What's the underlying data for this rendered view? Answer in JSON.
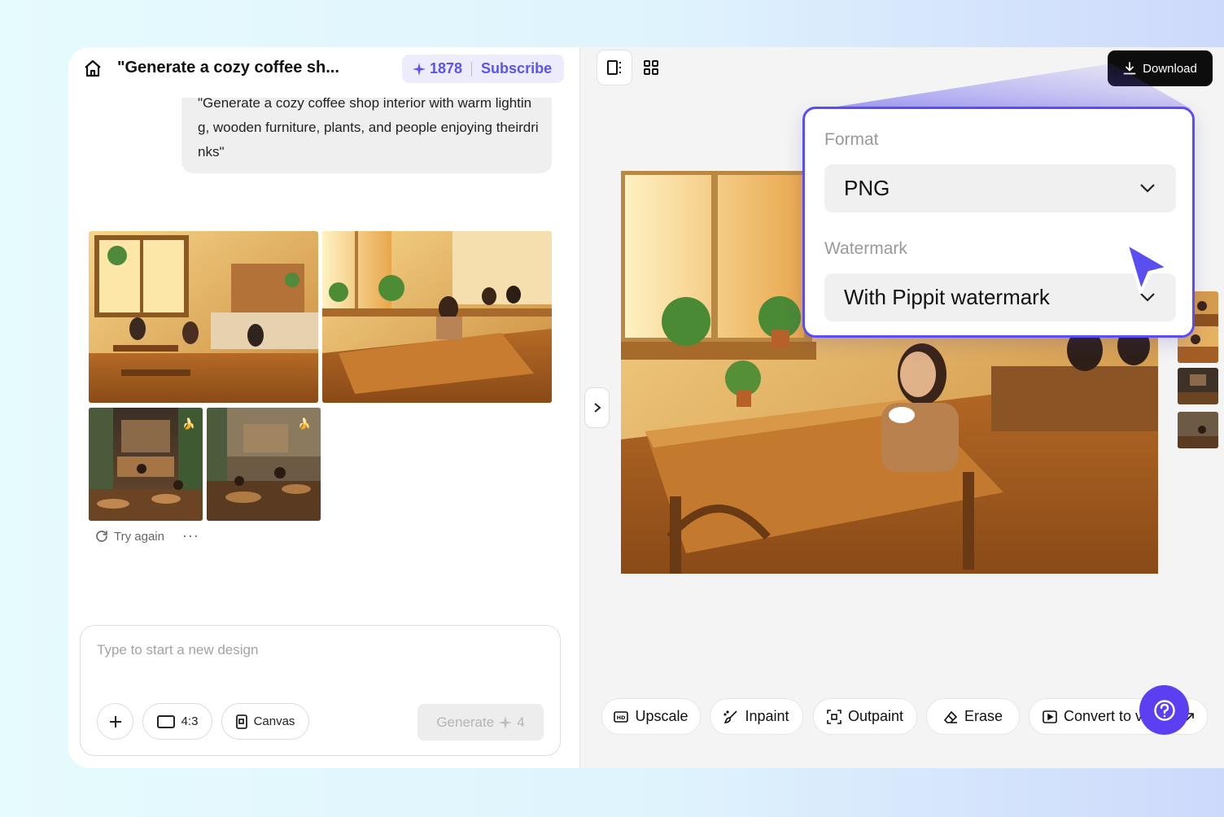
{
  "header": {
    "chat_title": "\"Generate a cozy coffee sh...",
    "credits": "1878",
    "subscribe_label": "Subscribe"
  },
  "prompt": {
    "text": "\"Generate a cozy coffee shop interior with warm lighting, wooden furniture, plants, and people enjoying theirdrinks\""
  },
  "results": {
    "try_again_label": "Try again",
    "more_label": "···"
  },
  "composer": {
    "placeholder": "Type to start a new design",
    "ratio_label": "4:3",
    "canvas_label": "Canvas",
    "generate_label": "Generate",
    "generate_cost": "4"
  },
  "toolbar": {
    "download_label": "Download"
  },
  "download_popover": {
    "format_label": "Format",
    "format_value": "PNG",
    "watermark_label": "Watermark",
    "watermark_value": "With Pippit watermark"
  },
  "tools": [
    {
      "label": "Upscale",
      "icon": "hd-icon"
    },
    {
      "label": "Inpaint",
      "icon": "brush-icon"
    },
    {
      "label": "Outpaint",
      "icon": "expand-icon"
    },
    {
      "label": "Erase",
      "icon": "eraser-icon"
    },
    {
      "label": "Convert to v",
      "icon": "video-icon"
    }
  ],
  "colors": {
    "accent": "#5b54e8",
    "popover_border": "#5a4ef0",
    "help_button": "#5b3ff0",
    "download_button": "#0d0d0d"
  }
}
